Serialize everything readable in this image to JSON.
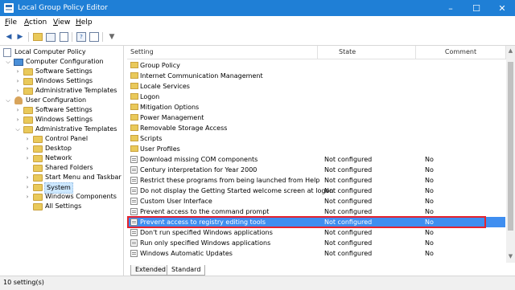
{
  "window": {
    "title": "Local Group Policy Editor"
  },
  "menubar": [
    {
      "label": "File",
      "u": "F",
      "rest": "ile"
    },
    {
      "label": "Action",
      "u": "A",
      "rest": "ction"
    },
    {
      "label": "View",
      "u": "V",
      "rest": "iew"
    },
    {
      "label": "Help",
      "u": "H",
      "rest": "elp"
    }
  ],
  "toolbar": {
    "back": "back-icon",
    "forward": "forward-icon",
    "up": "folder-up-icon",
    "show_hide": "show-hide-tree-icon",
    "export": "export-list-icon",
    "help": "help-icon",
    "properties": "properties-icon",
    "filter": "filter-icon"
  },
  "tree": {
    "root": "Local Computer Policy",
    "computer_config": "Computer Configuration",
    "cc_children": [
      "Software Settings",
      "Windows Settings",
      "Administrative Templates"
    ],
    "user_config": "User Configuration",
    "uc_children": [
      "Software Settings",
      "Windows Settings",
      "Administrative Templates"
    ],
    "admin_children": [
      "Control Panel",
      "Desktop",
      "Network",
      "Shared Folders",
      "Start Menu and Taskbar",
      "System",
      "Windows Components",
      "All Settings"
    ]
  },
  "table": {
    "headers": {
      "setting": "Setting",
      "state": "State",
      "comment": "Comment"
    },
    "folders": [
      "Group Policy",
      "Internet Communication Management",
      "Locale Services",
      "Logon",
      "Mitigation Options",
      "Power Management",
      "Removable Storage Access",
      "Scripts",
      "User Profiles"
    ],
    "settings": [
      {
        "name": "Download missing COM components",
        "state": "Not configured",
        "comment": "No"
      },
      {
        "name": "Century interpretation for Year 2000",
        "state": "Not configured",
        "comment": "No"
      },
      {
        "name": "Restrict these programs from being launched from Help",
        "state": "Not configured",
        "comment": "No"
      },
      {
        "name": "Do not display the Getting Started welcome screen at logon",
        "state": "Not configured",
        "comment": "No"
      },
      {
        "name": "Custom User Interface",
        "state": "Not configured",
        "comment": "No"
      },
      {
        "name": "Prevent access to the command prompt",
        "state": "Not configured",
        "comment": "No"
      },
      {
        "name": "Prevent access to registry editing tools",
        "state": "Not configured",
        "comment": "No"
      },
      {
        "name": "Don't run specified Windows applications",
        "state": "Not configured",
        "comment": "No"
      },
      {
        "name": "Run only specified Windows applications",
        "state": "Not configured",
        "comment": "No"
      },
      {
        "name": "Windows Automatic Updates",
        "state": "Not configured",
        "comment": "No"
      }
    ]
  },
  "tabs": [
    "Extended",
    "Standard"
  ],
  "status": {
    "text": "10 setting(s)"
  },
  "colors": {
    "titlebar": "#1f7fd6",
    "selection": "#3f8ef0",
    "highlight_border": "#e5232e"
  }
}
